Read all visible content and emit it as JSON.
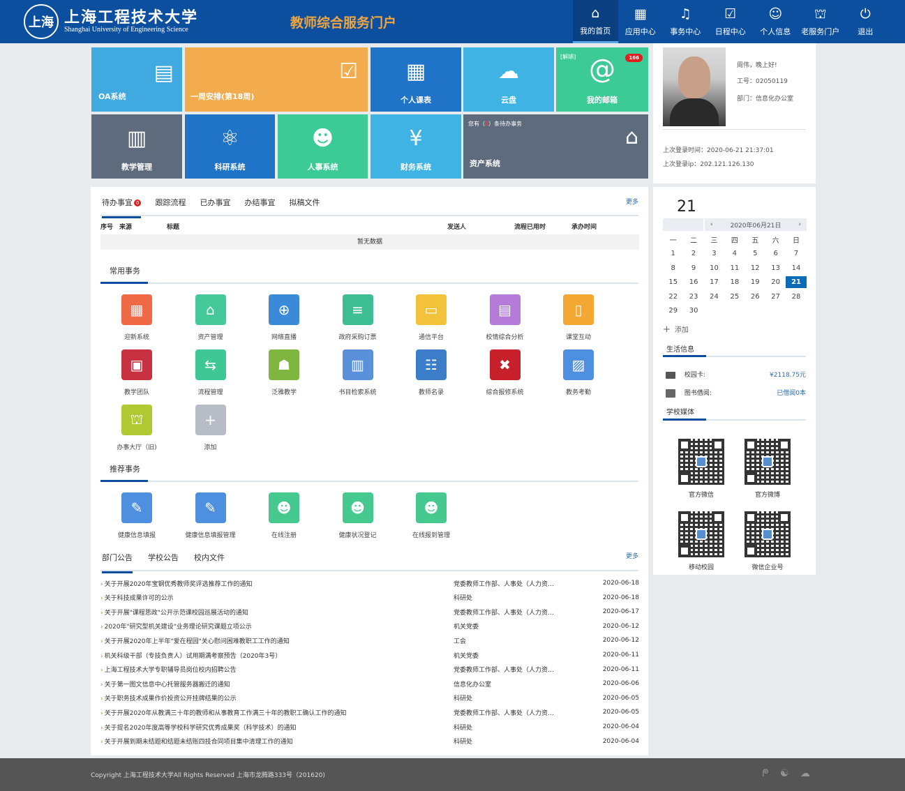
{
  "header": {
    "logo_seal": "上海",
    "school_cn": "上海工程技术大学",
    "school_en": "Shanghai University of Engineering Science",
    "portal_title": "教师综合服务门户",
    "nav": [
      {
        "label": "我的首页",
        "icon": "home-icon",
        "glyph": "⌂"
      },
      {
        "label": "应用中心",
        "icon": "grid-calendar-icon",
        "glyph": "▦"
      },
      {
        "label": "事务中心",
        "icon": "bell-icon",
        "glyph": "♫"
      },
      {
        "label": "日程中心",
        "icon": "calendar-check-icon",
        "glyph": "☑"
      },
      {
        "label": "个人信息",
        "icon": "user-icon",
        "glyph": "☺"
      },
      {
        "label": "老服务门户",
        "icon": "bank-icon",
        "glyph": "⛫"
      },
      {
        "label": "退出",
        "icon": "power-icon",
        "glyph": "⏻"
      }
    ]
  },
  "tiles": {
    "oa": "OA系统",
    "week": "一周安排(第18周)",
    "timetable": "个人课表",
    "cloud": "云盘",
    "mail": "我的邮箱",
    "mail_unbind": "[解绑]",
    "mail_count": "166",
    "teaching": "教学管理",
    "research": "科研系统",
    "hr": "人事系统",
    "finance": "财务系统",
    "asset": "资产系统",
    "pending_prefix": "您有（",
    "pending_count": "0",
    "pending_suffix": "）条待办事务"
  },
  "profile": {
    "greeting": "周伟，晚上好!",
    "id": "工号：02050119",
    "dept": "部门：信息化办公室",
    "last_login_time": "上次登录时间：2020-06-21 21:37:01",
    "last_login_ip": "上次登录ip：202.121.126.130"
  },
  "todo": {
    "tabs": [
      "待办事宜",
      "跟踪流程",
      "已办事宜",
      "办结事宜",
      "拟稿文件"
    ],
    "badge": "0",
    "more": "更多",
    "columns": [
      "序号",
      "来源",
      "标题",
      "发送人",
      "流程已用时",
      "承办时间"
    ],
    "empty": "暂无数据"
  },
  "common": {
    "title": "常用事务",
    "apps": [
      {
        "name": "迎新系统",
        "color": "#ef6a45",
        "glyph": "▦"
      },
      {
        "name": "资产管理",
        "color": "#45c99a",
        "glyph": "⌂"
      },
      {
        "name": "网络直播",
        "color": "#3b8ad9",
        "glyph": "⊕"
      },
      {
        "name": "政府采购订票",
        "color": "#3dbf93",
        "glyph": "≡"
      },
      {
        "name": "通信平台",
        "color": "#f2c23a",
        "glyph": "▭"
      },
      {
        "name": "校情综合分析",
        "color": "#b57bd9",
        "glyph": "▤"
      },
      {
        "name": "课堂互动",
        "color": "#f5a733",
        "glyph": "▯"
      },
      {
        "name": "教学团队",
        "color": "#c8313f",
        "glyph": "▣"
      },
      {
        "name": "流程管理",
        "color": "#3fc896",
        "glyph": "⇆"
      },
      {
        "name": "泛雅教学",
        "color": "#7fb640",
        "glyph": "☗"
      },
      {
        "name": "书目检索系统",
        "color": "#5a8fd9",
        "glyph": "▥"
      },
      {
        "name": "教师名录",
        "color": "#3b7dc9",
        "glyph": "☷"
      },
      {
        "name": "综合报修系统",
        "color": "#c8202a",
        "glyph": "✖"
      },
      {
        "name": "教务考勤",
        "color": "#4f8fe0",
        "glyph": "▨"
      },
      {
        "name": "办事大厅（旧)",
        "color": "#b0c933",
        "glyph": "⛫"
      },
      {
        "name": "添加",
        "color": "#b8bcc6",
        "glyph": "+"
      }
    ]
  },
  "recommend": {
    "title": "推荐事务",
    "apps": [
      {
        "name": "健康信息填报",
        "color": "#4f8fe0",
        "glyph": "✎"
      },
      {
        "name": "健康信息填报管理",
        "color": "#4f8fe0",
        "glyph": "✎"
      },
      {
        "name": "在线注册",
        "color": "#45c98f",
        "glyph": "☻"
      },
      {
        "name": "健康状况登记",
        "color": "#45c98f",
        "glyph": "☻"
      },
      {
        "name": "在线报到管理",
        "color": "#45c98f",
        "glyph": "☻"
      }
    ]
  },
  "notices": {
    "tabs": [
      "部门公告",
      "学校公告",
      "校内文件"
    ],
    "more": "更多",
    "rows": [
      {
        "title": "关于开展2020年宝钢优秀教师奖评选推荐工作的通知",
        "dept": "党委教师工作部、人事处（人力资…",
        "date": "2020-06-18"
      },
      {
        "title": "关于科技成果许可的公示",
        "dept": "科研处",
        "date": "2020-06-18"
      },
      {
        "title": "关于开展\"课程思政\"公开示范课校园巡展活动的通知",
        "dept": "党委教师工作部、人事处（人力资…",
        "date": "2020-06-17"
      },
      {
        "title": "2020年\"研究型机关建设\"业务理论研究课题立项公示",
        "dept": "机关党委",
        "date": "2020-06-12"
      },
      {
        "title": "关于开展2020年上半年\"爱在程园\"关心慰问困难教职工工作的通知",
        "dept": "工会",
        "date": "2020-06-12"
      },
      {
        "title": "机关科级干部（专技负责人）试用期满考察预告（2020年3号）",
        "dept": "机关党委",
        "date": "2020-06-11"
      },
      {
        "title": "上海工程技术大学专职辅导员岗位校内招聘公告",
        "dept": "党委教师工作部、人事处（人力资…",
        "date": "2020-06-11"
      },
      {
        "title": "关于第一图文信息中心托管服务器搬迁的通知",
        "dept": "信息化办公室",
        "date": "2020-06-06"
      },
      {
        "title": "关于职务技术成果作价投资公开挂牌结果的公示",
        "dept": "科研处",
        "date": "2020-06-05"
      },
      {
        "title": "关于开展2020年从教满三十年的教师和从事教育工作满三十年的教职工确认工作的通知",
        "dept": "党委教师工作部、人事处（人力资…",
        "date": "2020-06-05"
      },
      {
        "title": "关于提名2020年度高等学校科学研究优秀成果奖（科学技术）的通知",
        "dept": "科研处",
        "date": "2020-06-04"
      },
      {
        "title": "关于开展到期未结题和结题未结账四技合同项目集中清理工作的通知",
        "dept": "科研处",
        "date": "2020-06-04"
      }
    ]
  },
  "calendar": {
    "day": "21",
    "month_label": "2020年06月21日",
    "prev": "‹",
    "next": "›",
    "weekdays": [
      "一",
      "二",
      "三",
      "四",
      "五",
      "六",
      "日"
    ],
    "weeks": [
      [
        "1",
        "2",
        "3",
        "4",
        "5",
        "6",
        "7"
      ],
      [
        "8",
        "9",
        "10",
        "11",
        "12",
        "13",
        "14"
      ],
      [
        "15",
        "16",
        "17",
        "18",
        "19",
        "20",
        "21"
      ],
      [
        "22",
        "23",
        "24",
        "25",
        "26",
        "27",
        "28"
      ],
      [
        "29",
        "30",
        "",
        "",
        "",
        "",
        ""
      ]
    ],
    "today": "21",
    "add": "添加"
  },
  "life": {
    "title": "生活信息",
    "card_label": "校园卡:",
    "card_value": "¥2118.75元",
    "lib_label": "图书借阅:",
    "lib_value": "已借阅0本"
  },
  "media": {
    "title": "学校媒体",
    "qrs": [
      "官方微信",
      "官方微博",
      "移动校园",
      "微信企业号"
    ]
  },
  "footer": {
    "copyright": "Copyright 上海工程技术大学All Rights Reserved 上海市龙腾路333号（201620)",
    "social": "ᖘ ☯ ☁"
  },
  "colors": {
    "brand": "#0c4f9e",
    "accent": "#f0a53f"
  }
}
